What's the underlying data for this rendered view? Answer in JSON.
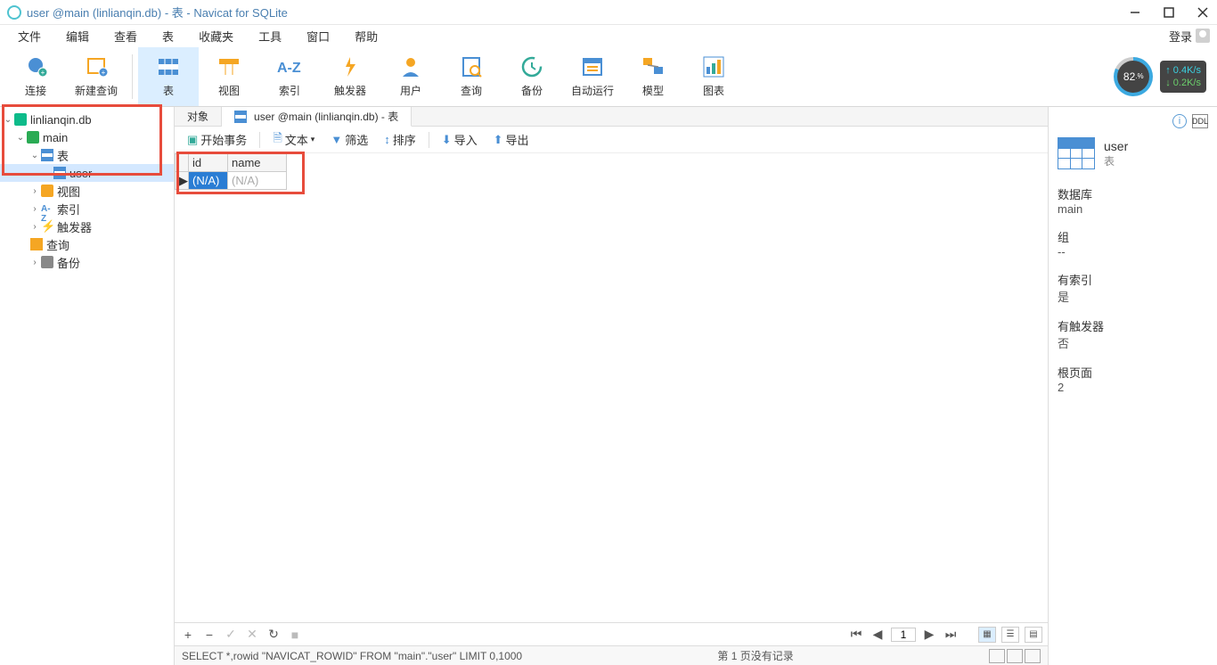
{
  "window": {
    "title": "user @main (linlianqin.db) - 表 - Navicat for SQLite"
  },
  "menubar": {
    "items": [
      "文件",
      "编辑",
      "查看",
      "表",
      "收藏夹",
      "工具",
      "窗口",
      "帮助"
    ],
    "login": "登录"
  },
  "toolbar": {
    "items": [
      {
        "label": "连接",
        "icon": "plug"
      },
      {
        "label": "新建查询",
        "icon": "query"
      },
      {
        "label": "表",
        "icon": "table",
        "active": true
      },
      {
        "label": "视图",
        "icon": "view"
      },
      {
        "label": "索引",
        "icon": "index"
      },
      {
        "label": "触发器",
        "icon": "trigger"
      },
      {
        "label": "用户",
        "icon": "user"
      },
      {
        "label": "查询",
        "icon": "querydoc"
      },
      {
        "label": "备份",
        "icon": "backup"
      },
      {
        "label": "自动运行",
        "icon": "auto"
      },
      {
        "label": "模型",
        "icon": "model"
      },
      {
        "label": "图表",
        "icon": "chart"
      }
    ]
  },
  "perf": {
    "percent": "82",
    "unit": "%",
    "up": "0.4K/s",
    "down": "0.2K/s"
  },
  "sidebar": {
    "db": "linlianqin.db",
    "schema": "main",
    "nodes": {
      "tables": "表",
      "user": "user",
      "views": "视图",
      "indexes": "索引",
      "triggers": "触发器",
      "queries": "查询",
      "backups": "备份"
    }
  },
  "tabs": {
    "objects": "对象",
    "userTab": "user @main (linlianqin.db) - 表"
  },
  "subtoolbar": {
    "begin": "开始事务",
    "text": "文本",
    "filter": "筛选",
    "sort": "排序",
    "import": "导入",
    "export": "导出"
  },
  "grid": {
    "columns": [
      "id",
      "name"
    ],
    "rows": [
      {
        "id": "(N/A)",
        "name": "(N/A)"
      }
    ]
  },
  "pager": {
    "page": "1"
  },
  "rightpanel": {
    "title": "user",
    "subtitle": "表",
    "fields": [
      {
        "label": "数据库",
        "value": "main"
      },
      {
        "label": "组",
        "value": "--"
      },
      {
        "label": "有索引",
        "value": "是"
      },
      {
        "label": "有触发器",
        "value": "否"
      },
      {
        "label": "根页面",
        "value": "2"
      }
    ],
    "ddl": "DDL"
  },
  "statusbar": {
    "sql": "SELECT *,rowid \"NAVICAT_ROWID\" FROM \"main\".\"user\" LIMIT 0,1000",
    "info": "第 1 页没有记录"
  }
}
